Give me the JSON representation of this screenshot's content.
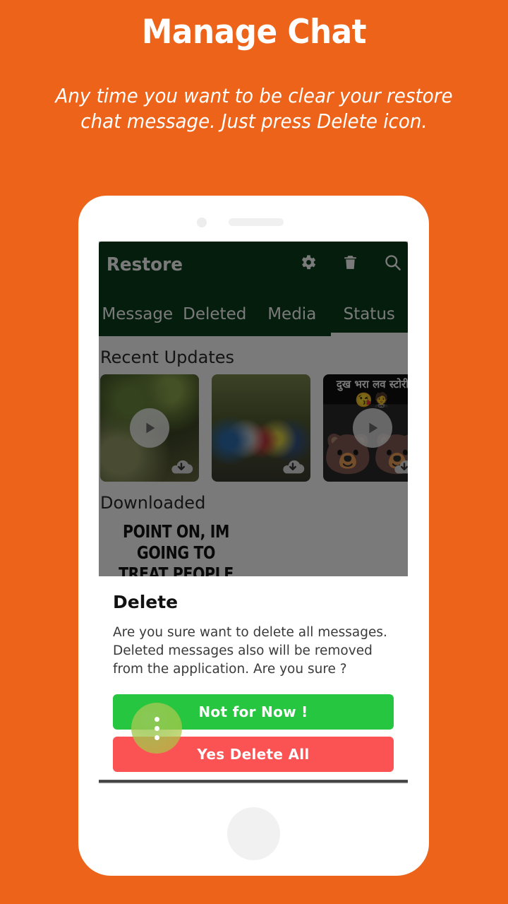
{
  "promo": {
    "title": "Manage Chat",
    "subtitle": "Any time you want to be clear your restore chat message. Just press Delete icon.",
    "background_color": "#EC6319",
    "text_color": "#FFFFFF"
  },
  "app": {
    "appbar": {
      "title": "Restore",
      "background_color": "#0A3D19",
      "actions": [
        {
          "name": "settings",
          "icon": "gear-icon"
        },
        {
          "name": "delete",
          "icon": "trash-icon"
        },
        {
          "name": "search",
          "icon": "search-icon"
        }
      ]
    },
    "tabs": [
      {
        "label": "Message",
        "active": false
      },
      {
        "label": "Deleted",
        "active": false
      },
      {
        "label": "Media",
        "active": false
      },
      {
        "label": "Status",
        "active": true
      }
    ],
    "sections": [
      {
        "label": "Recent Updates",
        "items": [
          {
            "kind": "video",
            "has_play": true,
            "has_download": true,
            "caption": ""
          },
          {
            "kind": "photo",
            "has_play": false,
            "has_download": true,
            "caption": ""
          },
          {
            "kind": "photo",
            "has_play": true,
            "has_download": true,
            "caption": "दुख भरा लव स्टोरी"
          }
        ]
      },
      {
        "label": "Downloaded",
        "items": [
          {
            "kind": "meme",
            "text": "POINT ON, IM GOING TO TREAT PEOPLE"
          },
          {
            "kind": "photo",
            "text": ""
          }
        ]
      }
    ]
  },
  "dialog": {
    "title": "Delete",
    "body": "Are you sure want to delete all messages. Deleted messages also will be removed from the application. Are you sure ?",
    "buttons": {
      "cancel_label": "Not  for Now !",
      "cancel_color": "#26C641",
      "confirm_label": "Yes Delete All",
      "confirm_color": "#FB5254"
    },
    "fab": {
      "icon": "more-vert-icon",
      "color": "#9AC85A"
    }
  }
}
